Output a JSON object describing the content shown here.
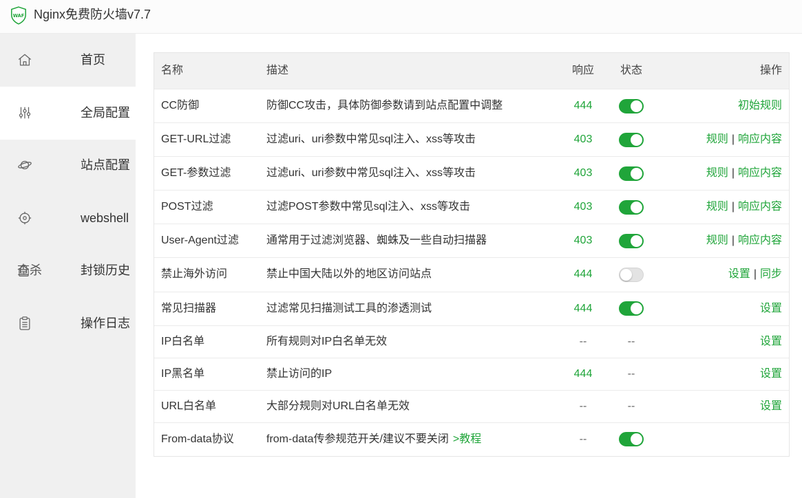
{
  "window": {
    "title": "Nginx免费防火墙v7.7",
    "logo_text": "WAF"
  },
  "colors": {
    "accent": "#20a53a",
    "sidebar_bg": "#f0f0f0"
  },
  "sidebar": {
    "items": [
      {
        "label": "首页",
        "icon": "home-icon",
        "active": false
      },
      {
        "label": "全局配置",
        "icon": "sliders-icon",
        "active": true
      },
      {
        "label": "站点配置",
        "icon": "planet-icon",
        "active": false
      },
      {
        "label": "webshell",
        "icon": "crosshair-icon",
        "active": false
      },
      {
        "label": "封锁历史",
        "icon": "lock-icon",
        "overlap_text": "查杀",
        "active": false
      },
      {
        "label": "操作日志",
        "icon": "clipboard-icon",
        "active": false
      }
    ]
  },
  "table": {
    "headers": {
      "name": "名称",
      "desc": "描述",
      "response": "响应",
      "status": "状态",
      "ops": "操作"
    },
    "ops_separator": "|",
    "rows": [
      {
        "name": "CC防御",
        "desc": "防御CC攻击，具体防御参数请到站点配置中调整",
        "response": "444",
        "status": true,
        "ops": [
          "初始规则"
        ]
      },
      {
        "name": "GET-URL过滤",
        "desc": "过滤uri、uri参数中常见sql注入、xss等攻击",
        "response": "403",
        "status": true,
        "ops": [
          "规则",
          "响应内容"
        ]
      },
      {
        "name": "GET-参数过滤",
        "desc": "过滤uri、uri参数中常见sql注入、xss等攻击",
        "response": "403",
        "status": true,
        "ops": [
          "规则",
          "响应内容"
        ]
      },
      {
        "name": "POST过滤",
        "desc": "过滤POST参数中常见sql注入、xss等攻击",
        "response": "403",
        "status": true,
        "ops": [
          "规则",
          "响应内容"
        ]
      },
      {
        "name": "User-Agent过滤",
        "desc": "通常用于过滤浏览器、蜘蛛及一些自动扫描器",
        "response": "403",
        "status": true,
        "ops": [
          "规则",
          "响应内容"
        ]
      },
      {
        "name": "禁止海外访问",
        "desc": "禁止中国大陆以外的地区访问站点",
        "response": "444",
        "status": false,
        "ops": [
          "设置",
          "同步"
        ]
      },
      {
        "name": "常见扫描器",
        "desc": "过滤常见扫描测试工具的渗透测试",
        "response": "444",
        "status": true,
        "ops": [
          "设置"
        ]
      },
      {
        "name": "IP白名单",
        "desc": "所有规则对IP白名单无效",
        "response": "--",
        "status": "--",
        "ops": [
          "设置"
        ]
      },
      {
        "name": "IP黑名单",
        "desc": "禁止访问的IP",
        "response": "444",
        "status": "--",
        "ops": [
          "设置"
        ]
      },
      {
        "name": "URL白名单",
        "desc": "大部分规则对URL白名单无效",
        "response": "--",
        "status": "--",
        "ops": [
          "设置"
        ]
      },
      {
        "name": "From-data协议",
        "desc": "from-data传参规范开关/建议不要关闭",
        "desc_link": ">教程",
        "response": "--",
        "status": true,
        "ops": []
      }
    ]
  }
}
